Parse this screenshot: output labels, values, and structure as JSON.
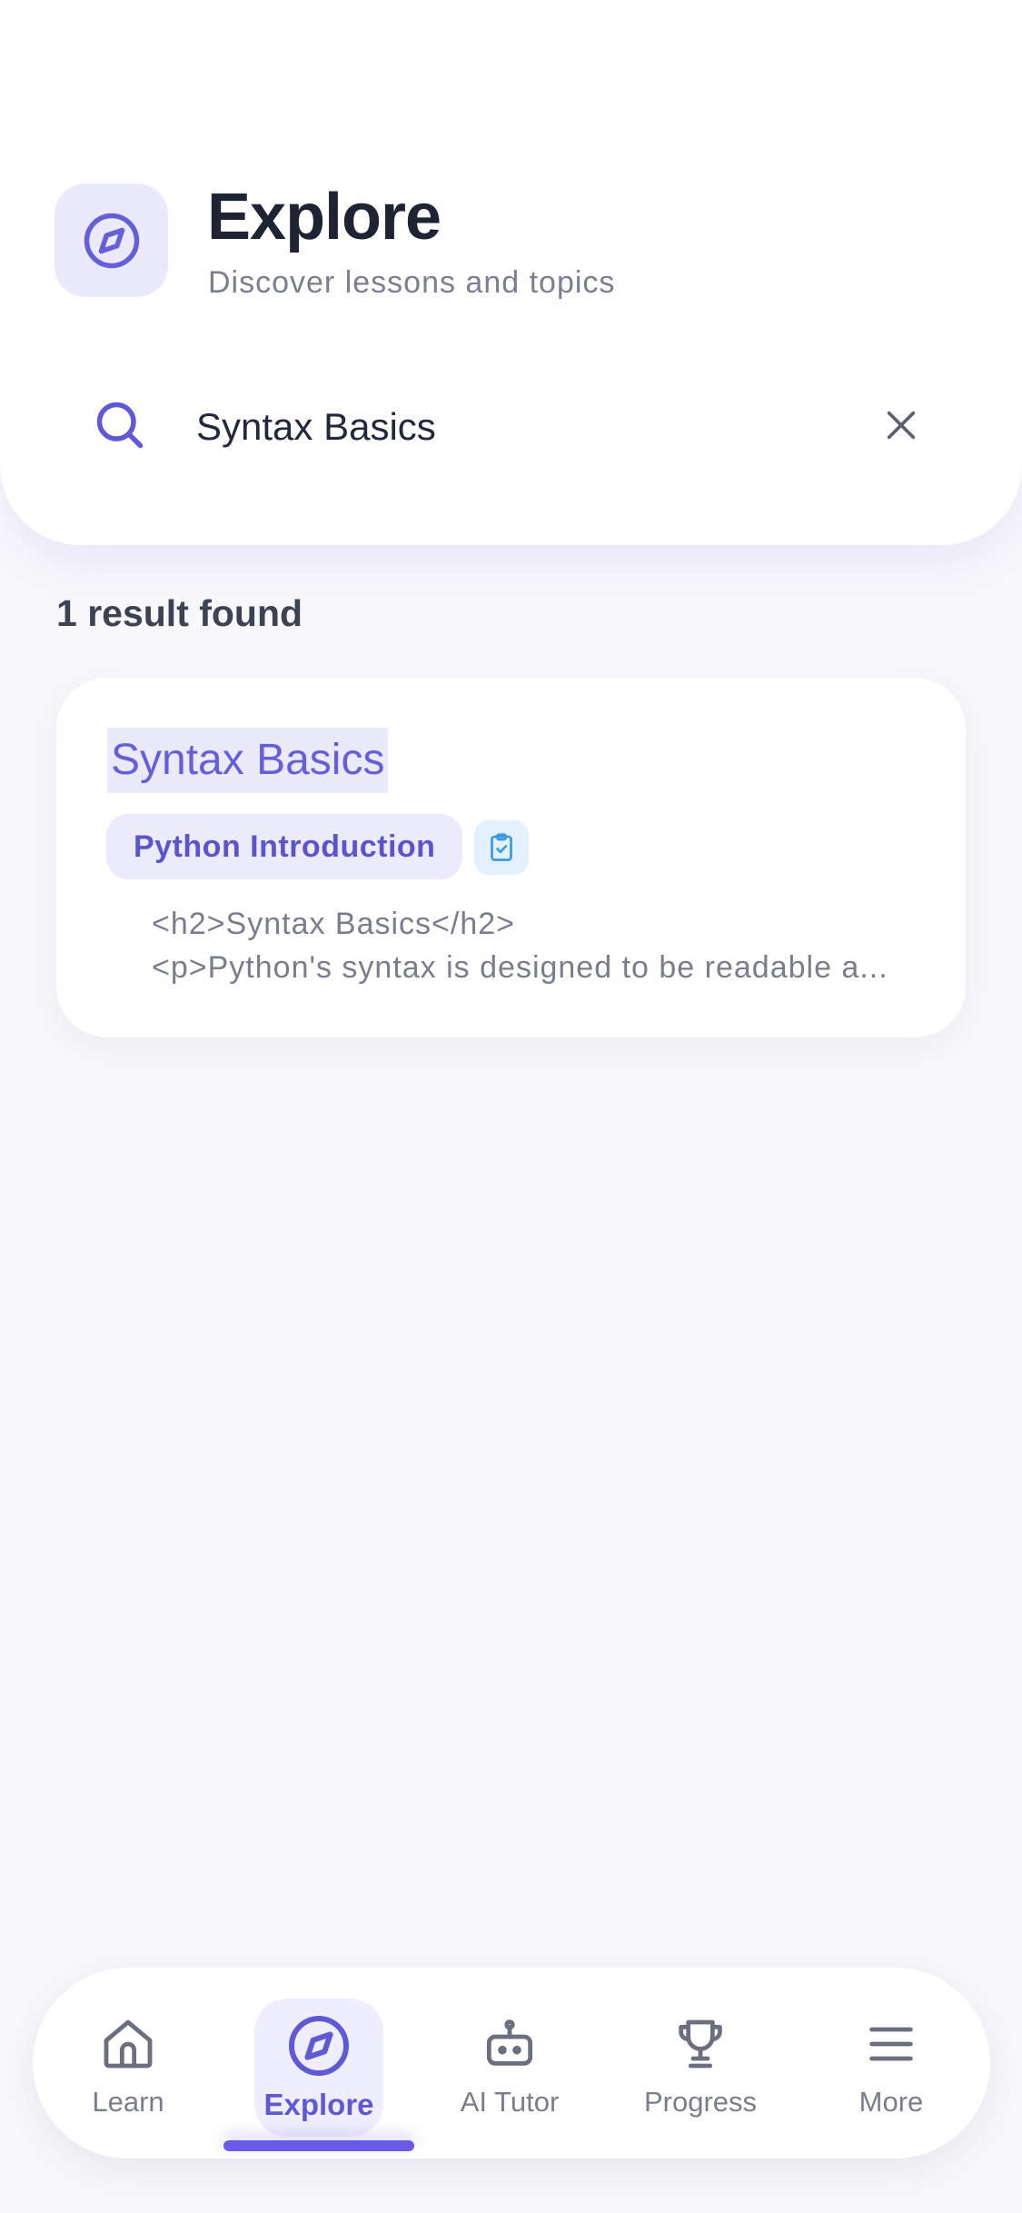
{
  "header": {
    "title": "Explore",
    "subtitle": "Discover lessons and topics",
    "badge_icon": "compass-icon"
  },
  "search": {
    "value": "Syntax Basics",
    "search_icon": "search-icon",
    "clear_icon": "close-icon"
  },
  "results": {
    "count_text": "1 result found",
    "items": [
      {
        "title": "Syntax Basics",
        "course": "Python Introduction",
        "type_icon": "clipboard-check-icon",
        "snippet_line1": "<h2>Syntax Basics</h2>",
        "snippet_line2": "<p>Python's syntax is designed to be readable a..."
      }
    ]
  },
  "nav": {
    "active": "Explore",
    "items": [
      {
        "label": "Learn",
        "icon": "home-icon"
      },
      {
        "label": "Explore",
        "icon": "compass-icon"
      },
      {
        "label": "AI Tutor",
        "icon": "robot-icon"
      },
      {
        "label": "Progress",
        "icon": "trophy-icon"
      },
      {
        "label": "More",
        "icon": "menu-icon"
      }
    ]
  },
  "colors": {
    "accent": "#5f59d6",
    "accent_light": "#ebeafd",
    "text_dark": "#1f2433",
    "text_muted": "#7a7e8c",
    "info_light": "#e2f1fc",
    "info": "#3b9ae0"
  }
}
